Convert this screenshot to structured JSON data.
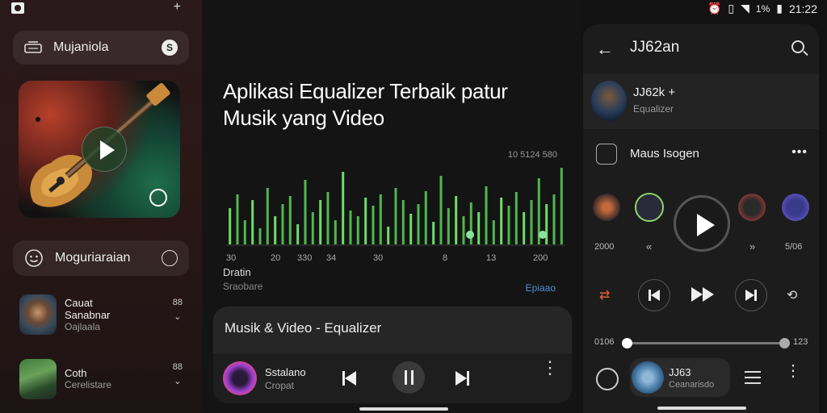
{
  "left": {
    "header_pill_label": "Mujaniola",
    "section_pill_label": "Moguriaraian",
    "items": [
      {
        "line1": "Cauat",
        "line2": "Sanabnar",
        "line3": "Oajlaala",
        "badge": "88"
      },
      {
        "line1": "Coth",
        "line2": "Cerelistare",
        "badge": "88"
      }
    ]
  },
  "center": {
    "headline": "Aplikasi Equalizer Terbaik patur Musik yang Video",
    "eq_time": "10 5124 580",
    "eq_axis": [
      "30",
      "20",
      "330",
      "34",
      "30",
      "8",
      "13",
      "200"
    ],
    "eq_label": "Dratin",
    "eq_sublabel": "Sraobare",
    "eq_link": "Epiaao",
    "card_title": "Musik & Video - Equalizer",
    "now_playing_title": "Sstalano",
    "now_playing_sub": "Cropat"
  },
  "status_bar": {
    "time": "21:22",
    "battery": "1%"
  },
  "right": {
    "title": "JJ62an",
    "artist_name": "JJ62k +",
    "artist_sub": "Equalizer",
    "row_label": "Maus Isogen",
    "left_time": "2000",
    "right_time": "5/06",
    "progress_start": "0106",
    "progress_end": "123",
    "mini_title": "JJ63",
    "mini_sub": "Ceanarisdo"
  },
  "eq_levels": [
    0.45,
    0.62,
    0.3,
    0.55,
    0.2,
    0.7,
    0.35,
    0.5,
    0.6,
    0.25,
    0.8,
    0.4,
    0.55,
    0.65,
    0.3,
    0.9,
    0.42,
    0.35,
    0.58,
    0.48,
    0.62,
    0.22,
    0.7,
    0.55,
    0.38,
    0.5,
    0.66,
    0.28,
    0.85,
    0.45,
    0.6,
    0.35,
    0.52,
    0.4,
    0.72,
    0.3,
    0.58,
    0.48,
    0.65,
    0.4,
    0.55,
    0.82,
    0.5,
    0.62,
    0.95
  ],
  "progress": 0.0
}
